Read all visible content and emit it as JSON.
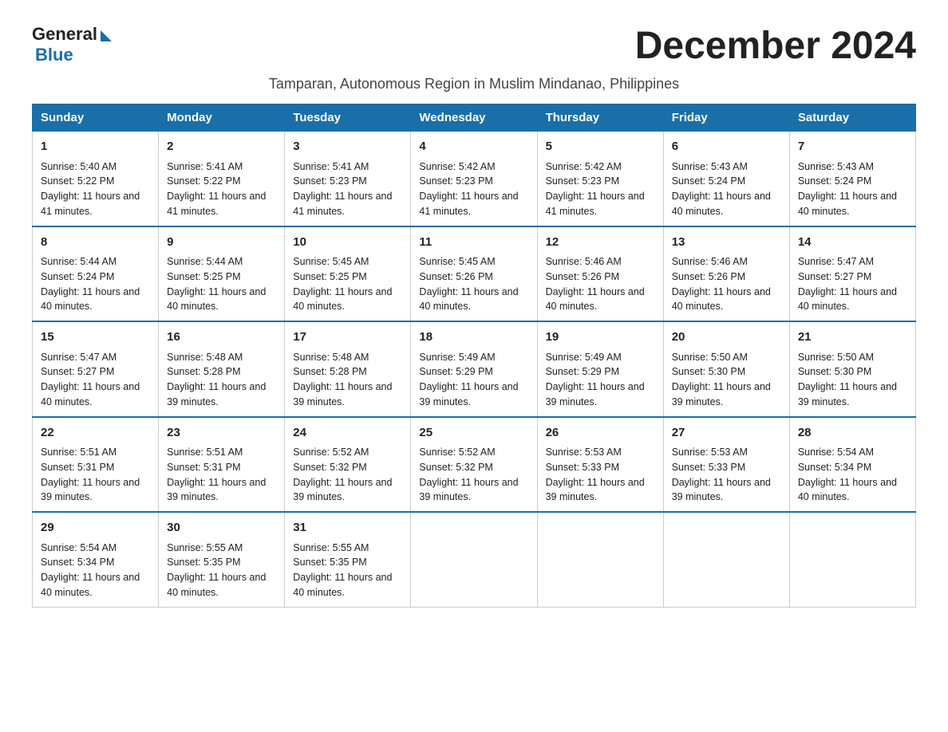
{
  "header": {
    "logo_general": "General",
    "logo_blue": "Blue",
    "month_title": "December 2024"
  },
  "subtitle": "Tamparan, Autonomous Region in Muslim Mindanao, Philippines",
  "days_of_week": [
    "Sunday",
    "Monday",
    "Tuesday",
    "Wednesday",
    "Thursday",
    "Friday",
    "Saturday"
  ],
  "weeks": [
    [
      {
        "day": "1",
        "sunrise": "5:40 AM",
        "sunset": "5:22 PM",
        "daylight": "11 hours and 41 minutes."
      },
      {
        "day": "2",
        "sunrise": "5:41 AM",
        "sunset": "5:22 PM",
        "daylight": "11 hours and 41 minutes."
      },
      {
        "day": "3",
        "sunrise": "5:41 AM",
        "sunset": "5:23 PM",
        "daylight": "11 hours and 41 minutes."
      },
      {
        "day": "4",
        "sunrise": "5:42 AM",
        "sunset": "5:23 PM",
        "daylight": "11 hours and 41 minutes."
      },
      {
        "day": "5",
        "sunrise": "5:42 AM",
        "sunset": "5:23 PM",
        "daylight": "11 hours and 41 minutes."
      },
      {
        "day": "6",
        "sunrise": "5:43 AM",
        "sunset": "5:24 PM",
        "daylight": "11 hours and 40 minutes."
      },
      {
        "day": "7",
        "sunrise": "5:43 AM",
        "sunset": "5:24 PM",
        "daylight": "11 hours and 40 minutes."
      }
    ],
    [
      {
        "day": "8",
        "sunrise": "5:44 AM",
        "sunset": "5:24 PM",
        "daylight": "11 hours and 40 minutes."
      },
      {
        "day": "9",
        "sunrise": "5:44 AM",
        "sunset": "5:25 PM",
        "daylight": "11 hours and 40 minutes."
      },
      {
        "day": "10",
        "sunrise": "5:45 AM",
        "sunset": "5:25 PM",
        "daylight": "11 hours and 40 minutes."
      },
      {
        "day": "11",
        "sunrise": "5:45 AM",
        "sunset": "5:26 PM",
        "daylight": "11 hours and 40 minutes."
      },
      {
        "day": "12",
        "sunrise": "5:46 AM",
        "sunset": "5:26 PM",
        "daylight": "11 hours and 40 minutes."
      },
      {
        "day": "13",
        "sunrise": "5:46 AM",
        "sunset": "5:26 PM",
        "daylight": "11 hours and 40 minutes."
      },
      {
        "day": "14",
        "sunrise": "5:47 AM",
        "sunset": "5:27 PM",
        "daylight": "11 hours and 40 minutes."
      }
    ],
    [
      {
        "day": "15",
        "sunrise": "5:47 AM",
        "sunset": "5:27 PM",
        "daylight": "11 hours and 40 minutes."
      },
      {
        "day": "16",
        "sunrise": "5:48 AM",
        "sunset": "5:28 PM",
        "daylight": "11 hours and 39 minutes."
      },
      {
        "day": "17",
        "sunrise": "5:48 AM",
        "sunset": "5:28 PM",
        "daylight": "11 hours and 39 minutes."
      },
      {
        "day": "18",
        "sunrise": "5:49 AM",
        "sunset": "5:29 PM",
        "daylight": "11 hours and 39 minutes."
      },
      {
        "day": "19",
        "sunrise": "5:49 AM",
        "sunset": "5:29 PM",
        "daylight": "11 hours and 39 minutes."
      },
      {
        "day": "20",
        "sunrise": "5:50 AM",
        "sunset": "5:30 PM",
        "daylight": "11 hours and 39 minutes."
      },
      {
        "day": "21",
        "sunrise": "5:50 AM",
        "sunset": "5:30 PM",
        "daylight": "11 hours and 39 minutes."
      }
    ],
    [
      {
        "day": "22",
        "sunrise": "5:51 AM",
        "sunset": "5:31 PM",
        "daylight": "11 hours and 39 minutes."
      },
      {
        "day": "23",
        "sunrise": "5:51 AM",
        "sunset": "5:31 PM",
        "daylight": "11 hours and 39 minutes."
      },
      {
        "day": "24",
        "sunrise": "5:52 AM",
        "sunset": "5:32 PM",
        "daylight": "11 hours and 39 minutes."
      },
      {
        "day": "25",
        "sunrise": "5:52 AM",
        "sunset": "5:32 PM",
        "daylight": "11 hours and 39 minutes."
      },
      {
        "day": "26",
        "sunrise": "5:53 AM",
        "sunset": "5:33 PM",
        "daylight": "11 hours and 39 minutes."
      },
      {
        "day": "27",
        "sunrise": "5:53 AM",
        "sunset": "5:33 PM",
        "daylight": "11 hours and 39 minutes."
      },
      {
        "day": "28",
        "sunrise": "5:54 AM",
        "sunset": "5:34 PM",
        "daylight": "11 hours and 40 minutes."
      }
    ],
    [
      {
        "day": "29",
        "sunrise": "5:54 AM",
        "sunset": "5:34 PM",
        "daylight": "11 hours and 40 minutes."
      },
      {
        "day": "30",
        "sunrise": "5:55 AM",
        "sunset": "5:35 PM",
        "daylight": "11 hours and 40 minutes."
      },
      {
        "day": "31",
        "sunrise": "5:55 AM",
        "sunset": "5:35 PM",
        "daylight": "11 hours and 40 minutes."
      },
      null,
      null,
      null,
      null
    ]
  ]
}
